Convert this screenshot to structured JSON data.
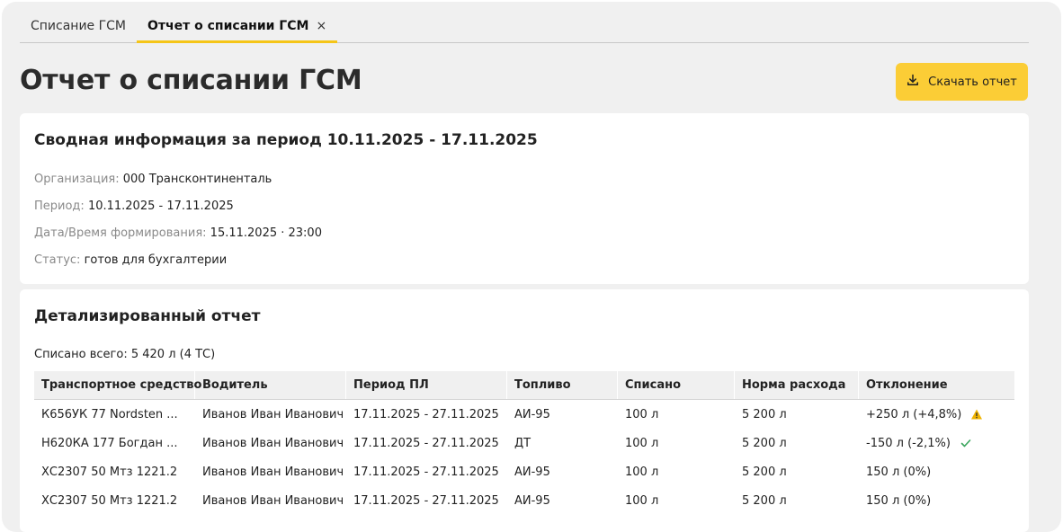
{
  "tabs": [
    {
      "label": "Списание ГСМ",
      "active": false
    },
    {
      "label": "Отчет о списании ГСМ",
      "active": true,
      "close": "×"
    }
  ],
  "header": {
    "title": "Отчет о списании ГСМ",
    "download_label": "Скачать отчет"
  },
  "summary": {
    "title": "Сводная информация за период 10.11.2025 - 17.11.2025",
    "rows": [
      {
        "label": "Организация:",
        "value": "000 Трансконтиненталь"
      },
      {
        "label": "Период:",
        "value": "10.11.2025 - 17.11.2025"
      },
      {
        "label": "Дата/Время формирования:",
        "value": "15.11.2025 · 23:00"
      },
      {
        "label": "Статус:",
        "value": "готов для бухгалтерии"
      }
    ]
  },
  "details": {
    "title": "Детализированный отчет",
    "total_label": "Списано всего:",
    "total_value": "5 420 л (4 ТС)",
    "columns": [
      "Транспортное средство",
      "Водитель",
      "Период ПЛ",
      "Топливо",
      "Списано",
      "Норма расхода",
      "Отклонение"
    ],
    "rows": [
      {
        "vehicle": "К656УК 77 Nordsten ...",
        "driver": "Иванов Иван Иванович",
        "period": "17.11.2025 - 27.11.2025",
        "fuel": "АИ-95",
        "written_off": "100 л",
        "norm": "5 200 л",
        "deviation": "+250 л (+4,8%)",
        "status": "warning-icon"
      },
      {
        "vehicle": "Н620КА 177 Богдан ...",
        "driver": "Иванов Иван Иванович",
        "period": "17.11.2025 - 27.11.2025",
        "fuel": "ДТ",
        "written_off": "100 л",
        "norm": "5 200 л",
        "deviation": "-150 л (-2,1%)",
        "status": "check-icon"
      },
      {
        "vehicle": "ХС2307 50 Мтз 1221.2",
        "driver": "Иванов Иван Иванович",
        "period": "17.11.2025 - 27.11.2025",
        "fuel": "АИ-95",
        "written_off": "100 л",
        "norm": "5 200 л",
        "deviation": "150 л (0%)",
        "status": ""
      },
      {
        "vehicle": "ХС2307 50 Мтз 1221.2",
        "driver": "Иванов Иван Иванович",
        "period": "17.11.2025 - 27.11.2025",
        "fuel": "АИ-95",
        "written_off": "100 л",
        "norm": "5 200 л",
        "deviation": "150 л (0%)",
        "status": ""
      }
    ]
  },
  "colors": {
    "accent": "#fbcd36",
    "warning": "#f0b400",
    "success": "#3aa55d"
  }
}
